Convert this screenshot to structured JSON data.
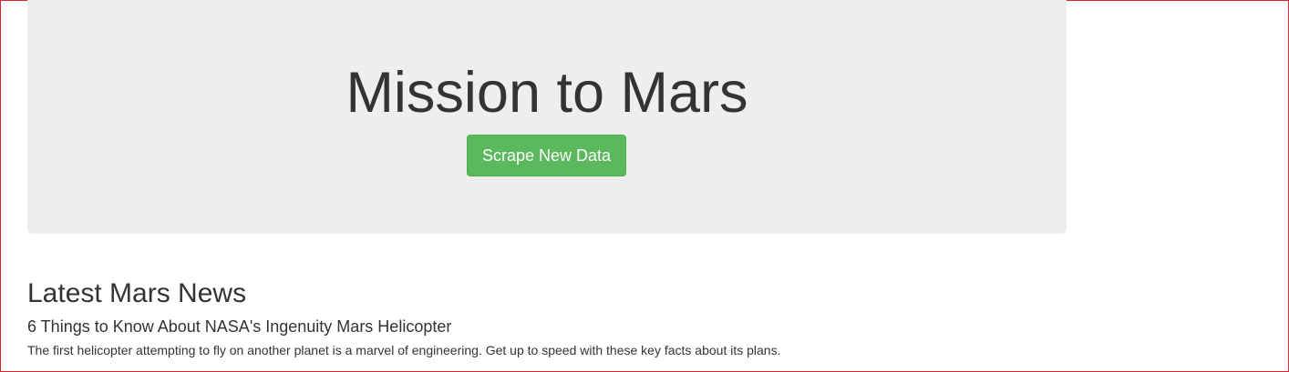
{
  "jumbotron": {
    "title": "Mission to Mars",
    "button_label": "Scrape New Data",
    "button_color": "#5cb85c"
  },
  "news": {
    "heading": "Latest Mars News",
    "title": "6 Things to Know About NASA's Ingenuity Mars Helicopter",
    "paragraph": "The first helicopter attempting to fly on another planet is a marvel of engineering. Get up to speed with these key facts about its plans."
  },
  "colors": {
    "jumbotron_background": "#eeeeee",
    "text": "#333333",
    "frame_border": "#d9232f"
  }
}
